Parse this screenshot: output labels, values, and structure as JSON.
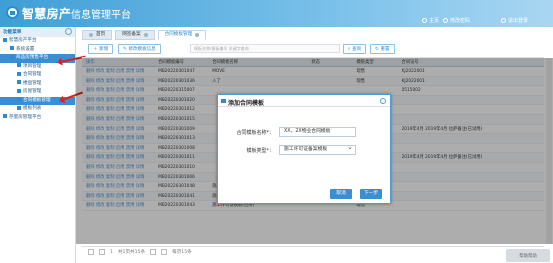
{
  "header": {
    "title_main": "智慧房产",
    "title_sub": "信息管理平台",
    "menu": [
      {
        "label": "主页",
        "icon": "home-icon"
      },
      {
        "label": "修改密码",
        "icon": "lock-icon"
      },
      {
        "label": "退出登录",
        "icon": "power-icon"
      }
    ]
  },
  "sidebar": {
    "title": "功能菜单",
    "items": [
      {
        "label": "智慧房产平台",
        "level": 1
      },
      {
        "label": "系统设置",
        "level": 2
      },
      {
        "label": "商品房预售平台",
        "level": 2,
        "active": true
      },
      {
        "label": "项目管理",
        "level": 3
      },
      {
        "label": "合同管理",
        "level": 3
      },
      {
        "label": "楼盘管理",
        "level": 3
      },
      {
        "label": "房屋管理",
        "level": 3
      },
      {
        "label": "合同模板管理",
        "level": 3,
        "active": true
      },
      {
        "label": "模板列表",
        "level": 3
      },
      {
        "label": "存量房管理平台",
        "level": 2
      }
    ]
  },
  "tabs": [
    "首页",
    "网签备案",
    "合同模板管理"
  ],
  "toolbar": {
    "add_label": "新增",
    "edit_label": "修改模板信息",
    "search_placeholder": "模板名称/模板编号 关键字查询",
    "query_label": "查询",
    "reset_label": "重置"
  },
  "table": {
    "columns": [
      "操作",
      "合同模板编号",
      "合同模板名称",
      "状态",
      "模板类型",
      "合同证号"
    ],
    "rows": [
      {
        "ops": "删除 修改 复制 启用 禁用 详情",
        "no": "MB20220301047",
        "name": "MOVE",
        "status": "",
        "type": "现售",
        "cert": "KJ2022001"
      },
      {
        "ops": "删除 修改 复制 启用 禁用 详情",
        "no": "MB20220301036",
        "name": "入了",
        "status": "",
        "type": "现售",
        "cert": "KJ2022001"
      },
      {
        "ops": "删除 修改 复制 启用 禁用 详情",
        "no": "MB20220315007",
        "name": "",
        "status": "",
        "type": "",
        "cert": "0515002"
      },
      {
        "ops": "删除 修改 复制 启用 禁用 详情",
        "no": "MB20220301020",
        "name": "",
        "status": "",
        "type": "",
        "cert": ""
      },
      {
        "ops": "删除 修改 复制 启用 禁用 详情",
        "no": "MB20220301012",
        "name": "",
        "status": "",
        "type": "",
        "cert": ""
      },
      {
        "ops": "删除 修改 复制 启用 禁用 详情",
        "no": "MB20220301015",
        "name": "",
        "status": "",
        "type": "",
        "cert": ""
      },
      {
        "ops": "删除 修改 复制 启用 禁用 详情",
        "no": "MB20220301009",
        "name": "",
        "status": "",
        "type": "",
        "cert": "2019年4月 2019年4月 拉萨备注(已试用)"
      },
      {
        "ops": "删除 修改 复制 启用 禁用 详情",
        "no": "MB20220301013",
        "name": "",
        "status": "",
        "type": "",
        "cert": ""
      },
      {
        "ops": "删除 修改 复制 启用 禁用 详情",
        "no": "MB20220301008",
        "name": "",
        "status": "",
        "type": "",
        "cert": ""
      },
      {
        "ops": "删除 修改 复制 启用 禁用 详情",
        "no": "MB20220301011",
        "name": "",
        "status": "",
        "type": "",
        "cert": "2019年4月 2019年4月 拉萨备注(已试用)"
      },
      {
        "ops": "删除 修改 复制 启用 禁用 详情",
        "no": "MB20220301010",
        "name": "",
        "status": "",
        "type": "",
        "cert": ""
      },
      {
        "ops": "删除 修改 复制 启用 禁用 详情",
        "no": "MB20220301006",
        "name": "",
        "status": "",
        "type": "",
        "cert": ""
      },
      {
        "ops": "删除 修改 复制 启用 禁用 详情",
        "no": "MB20220301048",
        "name": "施工许可证信息人员信息模板",
        "status": "",
        "type": "现售",
        "cert": ""
      },
      {
        "ops": "删除 修改 复制 启用 禁用 详情",
        "no": "MB20220301041",
        "name": "施工许可证模板(已备)",
        "status": "",
        "type": "现售",
        "cert": ""
      },
      {
        "ops": "删除 修改 复制 启用 禁用 详情",
        "no": "MB20220301043",
        "name": "施工许可证模板(已用)",
        "status": "",
        "type": "现售",
        "cert": ""
      }
    ]
  },
  "pager": {
    "page": "1",
    "of_label": "共1页共15条",
    "size_label": "每页15条"
  },
  "dialog": {
    "title": "添加合同模板",
    "name_label": "合同模板名称*：",
    "name_value": "XX，2X物业合同模板",
    "type_label": "模板类型*：",
    "type_value": "施工许可证备案模板",
    "cancel_label": "取消",
    "next_label": "下一步"
  },
  "corner_label": "帮助帮助"
}
